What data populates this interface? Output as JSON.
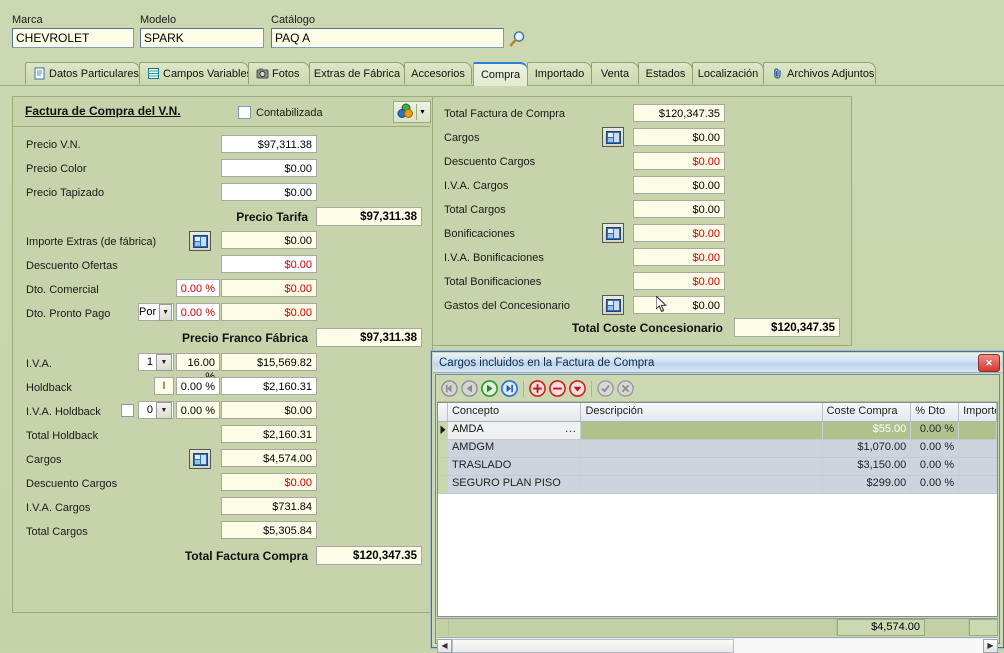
{
  "header": {
    "fields": [
      {
        "label": "Marca",
        "value": "CHEVROLET"
      },
      {
        "label": "Modelo",
        "value": "SPARK"
      },
      {
        "label": "Catálogo",
        "value": "PAQ A"
      }
    ],
    "search_icon": "magnifier-icon"
  },
  "tabs": [
    {
      "label": "Datos Particulares",
      "icon": "document-icon",
      "active": false
    },
    {
      "label": "Campos Variables",
      "icon": "table-icon",
      "active": false
    },
    {
      "label": "Fotos",
      "icon": "camera-icon",
      "active": false
    },
    {
      "label": "Extras de Fábrica",
      "icon": "",
      "active": false
    },
    {
      "label": "Accesorios",
      "icon": "",
      "active": false
    },
    {
      "label": "Compra",
      "icon": "",
      "active": true
    },
    {
      "label": "Importado",
      "icon": "",
      "active": false
    },
    {
      "label": "Venta",
      "icon": "",
      "active": false
    },
    {
      "label": "Estados",
      "icon": "",
      "active": false
    },
    {
      "label": "Localización",
      "icon": "",
      "active": false
    },
    {
      "label": "Archivos Adjuntos",
      "icon": "paperclip-icon",
      "active": false
    }
  ],
  "left_panel": {
    "title": "Factura de Compra del V.N.",
    "checkbox_label": "Contabilizada",
    "checkbox_checked": false,
    "money_button_icon": "money-globe-icon",
    "dropdown_icon": "chevron-down-icon",
    "rows": [
      {
        "label": "Precio V.N.",
        "value": "$97,311.38",
        "style": "white"
      },
      {
        "label": "Precio Color",
        "value": "$0.00",
        "style": "white"
      },
      {
        "label": "Precio Tapizado",
        "value": "$0.00",
        "style": "white"
      }
    ],
    "subtotal_1": {
      "label": "Precio Tarifa",
      "value": "$97,311.38"
    },
    "rows2": [
      {
        "label": "Importe Extras (de fábrica)",
        "value": "$0.00",
        "style": "cream",
        "button": "ellipsis-button"
      },
      {
        "label": "Descuento Ofertas",
        "value": "$0.00",
        "style": "white-red"
      },
      {
        "label": "Dto. Comercial",
        "pct": "0.00 %",
        "value": "$0.00",
        "style": "cream-red"
      },
      {
        "label": "Dto. Pronto Pago",
        "combo": "Por",
        "pct": "0.00 %",
        "value": "$0.00",
        "style": "cream-red"
      }
    ],
    "subtotal_2": {
      "label": "Precio Franco Fábrica",
      "value": "$97,311.38"
    },
    "rows3": [
      {
        "label": "I.V.A.",
        "combo": "1",
        "pct": "16.00 %",
        "value": "$15,569.82",
        "style": "cream"
      },
      {
        "label": "Holdback",
        "caret": "I",
        "pct": "0.00 %",
        "value": "$2,160.31",
        "style": "white"
      },
      {
        "label": "I.V.A. Holdback",
        "checkbox": true,
        "combo": "0",
        "pct": "0.00 %",
        "value": "$0.00",
        "style": "cream"
      },
      {
        "label": "Total Holdback",
        "value": "$2,160.31",
        "style": "cream"
      },
      {
        "label": "Cargos",
        "value": "$4,574.00",
        "style": "cream",
        "button": "ellipsis-button"
      },
      {
        "label": "Descuento Cargos",
        "value": "$0.00",
        "style": "cream-red"
      },
      {
        "label": "I.V.A. Cargos",
        "value": "$731.84",
        "style": "cream"
      },
      {
        "label": "Total Cargos",
        "value": "$5,305.84",
        "style": "cream"
      }
    ],
    "total": {
      "label": "Total Factura Compra",
      "value": "$120,347.35"
    }
  },
  "right_panel": {
    "rows": [
      {
        "label": "Total Factura de Compra",
        "value": "$120,347.35",
        "style": "cream"
      },
      {
        "label": "Cargos",
        "value": "$0.00",
        "style": "cream",
        "button": "ellipsis-button"
      },
      {
        "label": "Descuento Cargos",
        "value": "$0.00",
        "style": "cream-red"
      },
      {
        "label": "I.V.A. Cargos",
        "value": "$0.00",
        "style": "cream"
      },
      {
        "label": "Total Cargos",
        "value": "$0.00",
        "style": "cream"
      },
      {
        "label": "Bonificaciones",
        "value": "$0.00",
        "style": "cream-red",
        "button": "ellipsis-button"
      },
      {
        "label": "I.V.A. Bonificaciones",
        "value": "$0.00",
        "style": "cream-red"
      },
      {
        "label": "Total Bonificaciones",
        "value": "$0.00",
        "style": "cream-red"
      },
      {
        "label": "Gastos del Concesionario",
        "value": "$0.00",
        "style": "cream",
        "button": "ellipsis-button"
      }
    ],
    "total": {
      "label": "Total Coste Concesionario",
      "value": "$120,347.35"
    }
  },
  "dialog": {
    "title": "Cargos incluidos en la Factura de Compra",
    "close_icon": "close-icon",
    "navbuttons": [
      {
        "name": "first-record-button",
        "icon": "first-icon",
        "color": "#9a9a9a"
      },
      {
        "name": "prev-record-button",
        "icon": "prev-icon",
        "color": "#9a9a9a"
      },
      {
        "name": "next-record-button",
        "icon": "next-icon",
        "color": "#2b9a2b"
      },
      {
        "name": "last-record-button",
        "icon": "last-icon",
        "color": "#2a6fd4"
      },
      {
        "name": "insert-record-button",
        "icon": "plus-icon",
        "color": "#cc2222"
      },
      {
        "name": "delete-record-button",
        "icon": "minus-icon",
        "color": "#cc2222"
      },
      {
        "name": "edit-record-button",
        "icon": "edit-icon",
        "color": "#cc2222"
      },
      {
        "name": "post-edit-button",
        "icon": "check-icon",
        "color": "#9a9a9a"
      },
      {
        "name": "cancel-edit-button",
        "icon": "cancel-icon",
        "color": "#9a9a9a"
      }
    ],
    "grid": {
      "columns": [
        "Concepto",
        "Descripción",
        "Coste Compra",
        "% Dto",
        "Importe"
      ],
      "rows": [
        {
          "concepto": "AMDA",
          "descripcion": "",
          "coste": "$55.00",
          "dto": "0.00 %",
          "importe": "",
          "selected": true
        },
        {
          "concepto": "AMDGM",
          "descripcion": "",
          "coste": "$1,070.00",
          "dto": "0.00 %",
          "importe": "",
          "selected": false
        },
        {
          "concepto": "TRASLADO",
          "descripcion": "",
          "coste": "$3,150.00",
          "dto": "0.00 %",
          "importe": "",
          "selected": false
        },
        {
          "concepto": "SEGURO PLAN PISO",
          "descripcion": "",
          "coste": "$299.00",
          "dto": "0.00 %",
          "importe": "",
          "selected": false
        }
      ],
      "summary_total": "$4,574.00",
      "row_ellipsis": "…"
    },
    "hscroll": {
      "left_arrow": "◀",
      "right_arrow": "▶"
    }
  },
  "colors": {
    "app_bg": "#c8d4ae",
    "panel_bg": "#c7d3ab",
    "field_cream": "#fdfce6",
    "field_white": "#ffffff",
    "negative_red": "#cc0000",
    "tab_active_accent": "#2a7fd4",
    "grid_selected": "#b0c18b",
    "dialog_title_blue": "#bdd4ec"
  }
}
